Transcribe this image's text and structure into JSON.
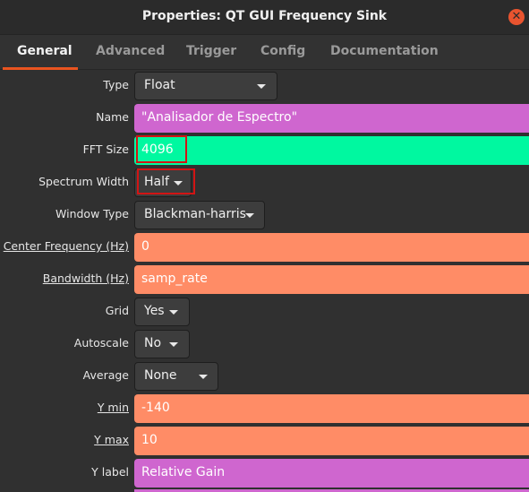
{
  "window": {
    "title": "Properties: QT GUI Frequency Sink"
  },
  "tabs": [
    {
      "label": "General"
    },
    {
      "label": "Advanced"
    },
    {
      "label": "Trigger"
    },
    {
      "label": "Config"
    },
    {
      "label": "Documentation"
    }
  ],
  "fields": {
    "type": {
      "label": "Type",
      "value": "Float"
    },
    "name": {
      "label": "Name",
      "value": "\"Analisador de Espectro\""
    },
    "fft_size": {
      "label": "FFT Size",
      "value": "4096"
    },
    "spectrum_width": {
      "label": "Spectrum Width",
      "value": "Half"
    },
    "window_type": {
      "label": "Window Type",
      "value": "Blackman-harris"
    },
    "center_frequency": {
      "label": "Center Frequency (Hz)",
      "value": "0"
    },
    "bandwidth": {
      "label": "Bandwidth (Hz)",
      "value": "samp_rate"
    },
    "grid": {
      "label": "Grid",
      "value": "Yes"
    },
    "autoscale": {
      "label": "Autoscale",
      "value": "No"
    },
    "average": {
      "label": "Average",
      "value": "None"
    },
    "y_min": {
      "label": "Y min",
      "value": "-140"
    },
    "y_max": {
      "label": "Y max",
      "value": "10"
    },
    "y_label": {
      "label": "Y label",
      "value": "Relative Gain"
    }
  },
  "colors": {
    "accent": "#e95420",
    "entry_string": "#cf66cf",
    "entry_int": "#00f8a0",
    "entry_real": "#ff8c66",
    "highlight_box": "#d21414"
  }
}
